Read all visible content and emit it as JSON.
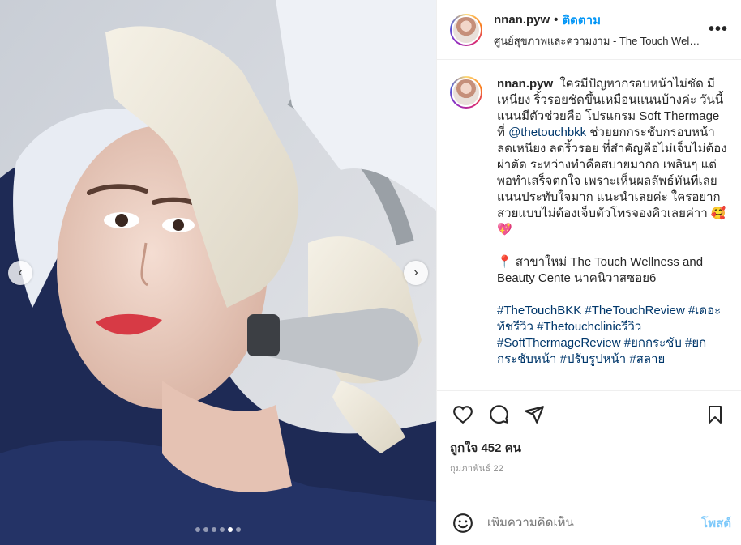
{
  "post": {
    "username": "nnan.pyw",
    "separator": "•",
    "follow_label": "ติดตาม",
    "location": "ศูนย์สุขภาพและความงาม - The Touch Wellness and Beauty Center",
    "more_icon": "ellipsis-icon",
    "caption_text": "ใครมีปัญหากรอบหน้าไม่ชัด มีเหนียง ริ้วรอยชัดขึ้นเหมือนแนนบ้างค่ะ วันนี้แนนมีตัวช่วยคือ โปรแกรม Soft Thermage ที่ ",
    "mention": "@thetouchbkk",
    "caption_text_2": " ช่วยยกกระชับกรอบหน้า ลดเหนียง ลดริ้วรอย ที่สำคัญคือไม่เจ็บไม่ต้องผ่าตัด ระหว่างทำคือสบายมากก เพลินๆ แต่พอทำเสร็จตกใจ เพราะเห็นผลลัพธ์ทันทีเลย แนนประทับใจมาก แนะนำเลยค่ะ ใครอยากสวยแบบไม่ต้องเจ็บตัวโทรจองคิวเลยค่าา 🥰 💖",
    "location_line": "📍 สาขาใหม่ The Touch Wellness and Beauty Cente นาคนิวาสซอย6",
    "hashtags": "#TheTouchBKK #TheTouchReview #เดอะทัชรีวิว #Thetouchclinicรีวิว #SoftThermageReview #ยกกระชับ #ยกกระชับหน้า #ปรับรูปหน้า #สลาย",
    "likes": "ถูกใจ 452 คน",
    "date": "กุมภาพันธ์ 22",
    "comment_placeholder": "เพิ่มความคิดเห็น",
    "post_label": "โพสต์"
  },
  "carousel": {
    "total_slides": 6,
    "active_index": 4
  },
  "icons": {
    "like": "heart-icon",
    "comment": "comment-icon",
    "share": "share-icon",
    "save": "bookmark-icon",
    "emoji": "emoji-icon",
    "prev": "chevron-left-icon",
    "next": "chevron-right-icon"
  },
  "colors": {
    "accent": "#0095f6",
    "link": "#00376b",
    "muted": "#8e8e8e"
  }
}
